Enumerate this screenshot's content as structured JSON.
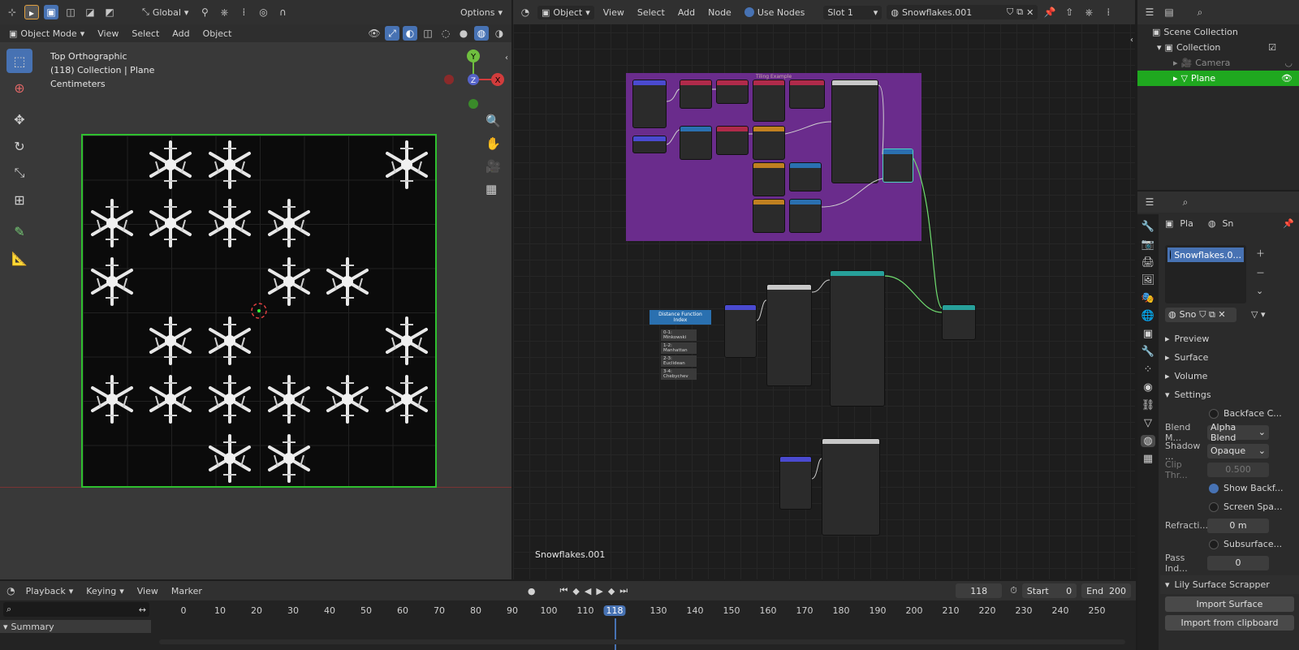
{
  "viewport": {
    "header": {
      "orientation": "Global",
      "options": "Options"
    },
    "subheader": {
      "mode": "Object Mode",
      "menus": [
        "View",
        "Select",
        "Add",
        "Object"
      ]
    },
    "overlay": {
      "view_name": "Top Orthographic",
      "collection": "(118) Collection | Plane",
      "units": "Centimeters"
    },
    "gizmo": {
      "y": "Y",
      "x": "X",
      "z": "Z"
    }
  },
  "node_editor": {
    "header": {
      "type": "Object",
      "menus": [
        "View",
        "Select",
        "Add",
        "Node"
      ],
      "use_nodes": "Use Nodes",
      "slot": "Slot 1",
      "material": "Snowflakes.001"
    },
    "frame_label": "Tiling Example",
    "distance_menu": {
      "title": "Distance Function Index",
      "items": [
        "0-1: Minkowski",
        "1-2: Manhattan",
        "2-3: Euclidean",
        "3-4: Chebychev"
      ]
    },
    "material_name": "Snowflakes.001"
  },
  "outliner": {
    "items": [
      {
        "label": "Scene Collection"
      },
      {
        "label": "Collection"
      },
      {
        "label": "Camera"
      },
      {
        "label": "Plane"
      }
    ]
  },
  "properties": {
    "tabs": [
      "Pla",
      "Sn"
    ],
    "slot_name": "Snowflakes.0...",
    "mat_short": "Sno",
    "panels": [
      "Preview",
      "Surface",
      "Volume",
      "Settings"
    ],
    "settings": {
      "backface": "Backface C...",
      "blend_label": "Blend M...",
      "blend_value": "Alpha Blend",
      "shadow_label": "Shadow ...",
      "shadow_value": "Opaque",
      "clip_label": "Clip Thr...",
      "clip_value": "0.500",
      "show_back": "Show Backf...",
      "screen_space": "Screen Spa...",
      "refraction_label": "Refracti...",
      "refraction_value": "0 m",
      "subsurface": "Subsurface...",
      "pass_label": "Pass Ind...",
      "pass_value": "0"
    },
    "addon": {
      "title": "Lily Surface Scrapper",
      "import_surface": "Import Surface",
      "import_clipboard": "Import from clipboard"
    }
  },
  "timeline": {
    "menus": [
      "Playback",
      "Keying",
      "View",
      "Marker"
    ],
    "current_frame": "118",
    "start_label": "Start",
    "start_value": "0",
    "end_label": "End",
    "end_value": "200",
    "summary": "Summary",
    "ruler": [
      "0",
      "10",
      "20",
      "30",
      "40",
      "50",
      "60",
      "70",
      "80",
      "90",
      "100",
      "110",
      "118",
      "130",
      "140",
      "150",
      "160",
      "170",
      "180",
      "190",
      "200",
      "210",
      "220",
      "230",
      "240",
      "250"
    ]
  }
}
